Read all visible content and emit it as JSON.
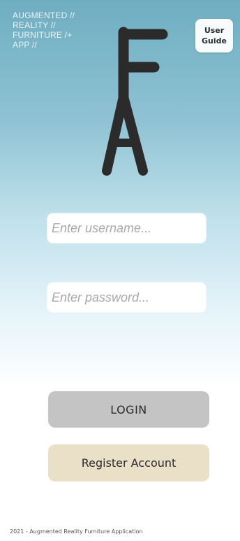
{
  "brand": {
    "lines": [
      "AUGMENTED //",
      "REALITY //",
      "FURNITURE /+",
      "APP //"
    ]
  },
  "header": {
    "guide_label": "User\nGuide"
  },
  "logo": {
    "icon": "fa-monogram-icon",
    "color": "#2b2b2b"
  },
  "form": {
    "username_placeholder": "Enter username...",
    "username_value": "",
    "password_placeholder": "Enter password...",
    "password_value": ""
  },
  "actions": {
    "login_label": "LOGIN",
    "register_label": "Register Account"
  },
  "footer": {
    "text": "2021 - Augmented Reality Furniture Application"
  },
  "colors": {
    "login_bg": "#c4c4c4",
    "register_bg": "#eae0c8",
    "gradient_top": "#6fadc1"
  }
}
